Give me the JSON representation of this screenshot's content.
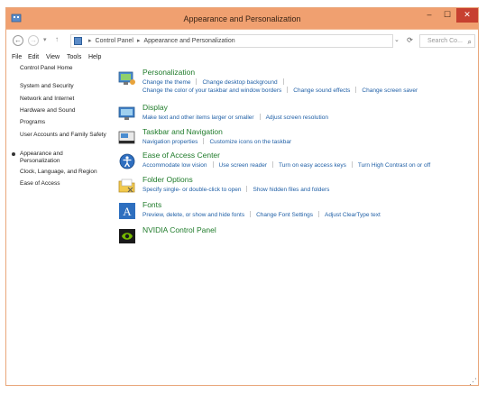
{
  "window": {
    "title": "Appearance and Personalization",
    "minimize": "–",
    "maximize": "☐",
    "close": "✕"
  },
  "address": {
    "path_root": "Control Panel",
    "path_current": "Appearance and Personalization",
    "separator": "▸",
    "search_placeholder": "Search Co..."
  },
  "menu": {
    "items": [
      "File",
      "Edit",
      "View",
      "Tools",
      "Help"
    ]
  },
  "sidebar": {
    "items": [
      {
        "label": "Control Panel Home"
      },
      {
        "label": "System and Security"
      },
      {
        "label": "Network and Internet"
      },
      {
        "label": "Hardware and Sound"
      },
      {
        "label": "Programs"
      },
      {
        "label": "User Accounts and Family Safety"
      },
      {
        "label": "Appearance and Personalization"
      },
      {
        "label": "Clock, Language, and Region"
      },
      {
        "label": "Ease of Access"
      }
    ]
  },
  "categories": [
    {
      "title": "Personalization",
      "icon": "personalization-icon",
      "links": [
        [
          "Change the theme",
          "Change desktop background"
        ],
        [
          "Change the color of your taskbar and window borders",
          "Change sound effects",
          "Change screen saver"
        ]
      ]
    },
    {
      "title": "Display",
      "icon": "display-icon",
      "links": [
        [
          "Make text and other items larger or smaller",
          "Adjust screen resolution"
        ]
      ]
    },
    {
      "title": "Taskbar and Navigation",
      "icon": "taskbar-icon",
      "links": [
        [
          "Navigation properties",
          "Customize icons on the taskbar"
        ]
      ]
    },
    {
      "title": "Ease of Access Center",
      "icon": "ease-of-access-icon",
      "links": [
        [
          "Accommodate low vision",
          "Use screen reader",
          "Turn on easy access keys",
          "Turn High Contrast on or off"
        ]
      ]
    },
    {
      "title": "Folder Options",
      "icon": "folder-options-icon",
      "links": [
        [
          "Specify single- or double-click to open",
          "Show hidden files and folders"
        ]
      ]
    },
    {
      "title": "Fonts",
      "icon": "fonts-icon",
      "links": [
        [
          "Preview, delete, or show and hide fonts",
          "Change Font Settings",
          "Adjust ClearType text"
        ]
      ]
    },
    {
      "title": "NVIDIA Control Panel",
      "icon": "nvidia-icon",
      "links": []
    }
  ],
  "colors": {
    "titlebar": "#f0a070",
    "category_title": "#1f7b2a",
    "link": "#1f5fa6"
  }
}
